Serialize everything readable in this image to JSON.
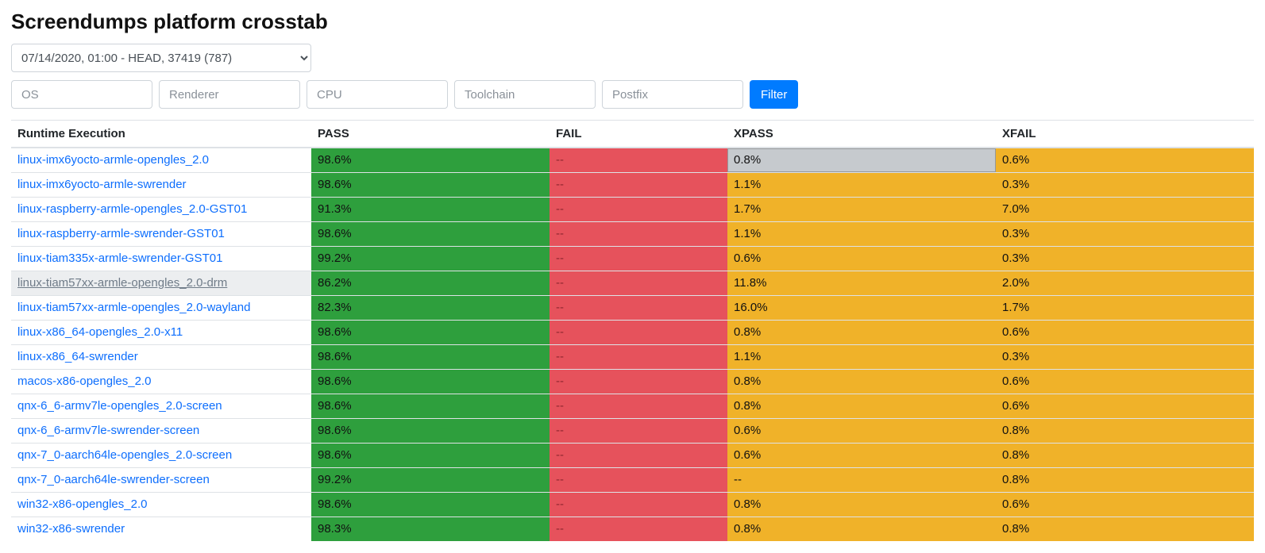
{
  "title": "Screendumps platform crosstab",
  "build_select": {
    "selected": "07/14/2020, 01:00 - HEAD, 37419 (787)"
  },
  "filters": {
    "os_placeholder": "OS",
    "renderer_placeholder": "Renderer",
    "cpu_placeholder": "CPU",
    "toolchain_placeholder": "Toolchain",
    "postfix_placeholder": "Postfix",
    "button_label": "Filter"
  },
  "columns": {
    "name": "Runtime Execution",
    "pass": "PASS",
    "fail": "FAIL",
    "xpass": "XPASS",
    "xfail": "XFAIL"
  },
  "rows": [
    {
      "name": "linux-imx6yocto-armle-opengles_2.0",
      "pass": "98.6%",
      "fail": "--",
      "xpass": "0.8%",
      "xfail": "0.6%",
      "xpass_selected": true
    },
    {
      "name": "linux-imx6yocto-armle-swrender",
      "pass": "98.6%",
      "fail": "--",
      "xpass": "1.1%",
      "xfail": "0.3%"
    },
    {
      "name": "linux-raspberry-armle-opengles_2.0-GST01",
      "pass": "91.3%",
      "fail": "--",
      "xpass": "1.7%",
      "xfail": "7.0%"
    },
    {
      "name": "linux-raspberry-armle-swrender-GST01",
      "pass": "98.6%",
      "fail": "--",
      "xpass": "1.1%",
      "xfail": "0.3%"
    },
    {
      "name": "linux-tiam335x-armle-swrender-GST01",
      "pass": "99.2%",
      "fail": "--",
      "xpass": "0.6%",
      "xfail": "0.3%"
    },
    {
      "name": "linux-tiam57xx-armle-opengles_2.0-drm",
      "pass": "86.2%",
      "fail": "--",
      "xpass": "11.8%",
      "xfail": "2.0%",
      "hovered": true
    },
    {
      "name": "linux-tiam57xx-armle-opengles_2.0-wayland",
      "pass": "82.3%",
      "fail": "--",
      "xpass": "16.0%",
      "xfail": "1.7%"
    },
    {
      "name": "linux-x86_64-opengles_2.0-x11",
      "pass": "98.6%",
      "fail": "--",
      "xpass": "0.8%",
      "xfail": "0.6%"
    },
    {
      "name": "linux-x86_64-swrender",
      "pass": "98.6%",
      "fail": "--",
      "xpass": "1.1%",
      "xfail": "0.3%"
    },
    {
      "name": "macos-x86-opengles_2.0",
      "pass": "98.6%",
      "fail": "--",
      "xpass": "0.8%",
      "xfail": "0.6%"
    },
    {
      "name": "qnx-6_6-armv7le-opengles_2.0-screen",
      "pass": "98.6%",
      "fail": "--",
      "xpass": "0.8%",
      "xfail": "0.6%"
    },
    {
      "name": "qnx-6_6-armv7le-swrender-screen",
      "pass": "98.6%",
      "fail": "--",
      "xpass": "0.6%",
      "xfail": "0.8%"
    },
    {
      "name": "qnx-7_0-aarch64le-opengles_2.0-screen",
      "pass": "98.6%",
      "fail": "--",
      "xpass": "0.6%",
      "xfail": "0.8%"
    },
    {
      "name": "qnx-7_0-aarch64le-swrender-screen",
      "pass": "99.2%",
      "fail": "--",
      "xpass": "--",
      "xfail": "0.8%"
    },
    {
      "name": "win32-x86-opengles_2.0",
      "pass": "98.6%",
      "fail": "--",
      "xpass": "0.8%",
      "xfail": "0.6%"
    },
    {
      "name": "win32-x86-swrender",
      "pass": "98.3%",
      "fail": "--",
      "xpass": "0.8%",
      "xfail": "0.8%"
    }
  ]
}
